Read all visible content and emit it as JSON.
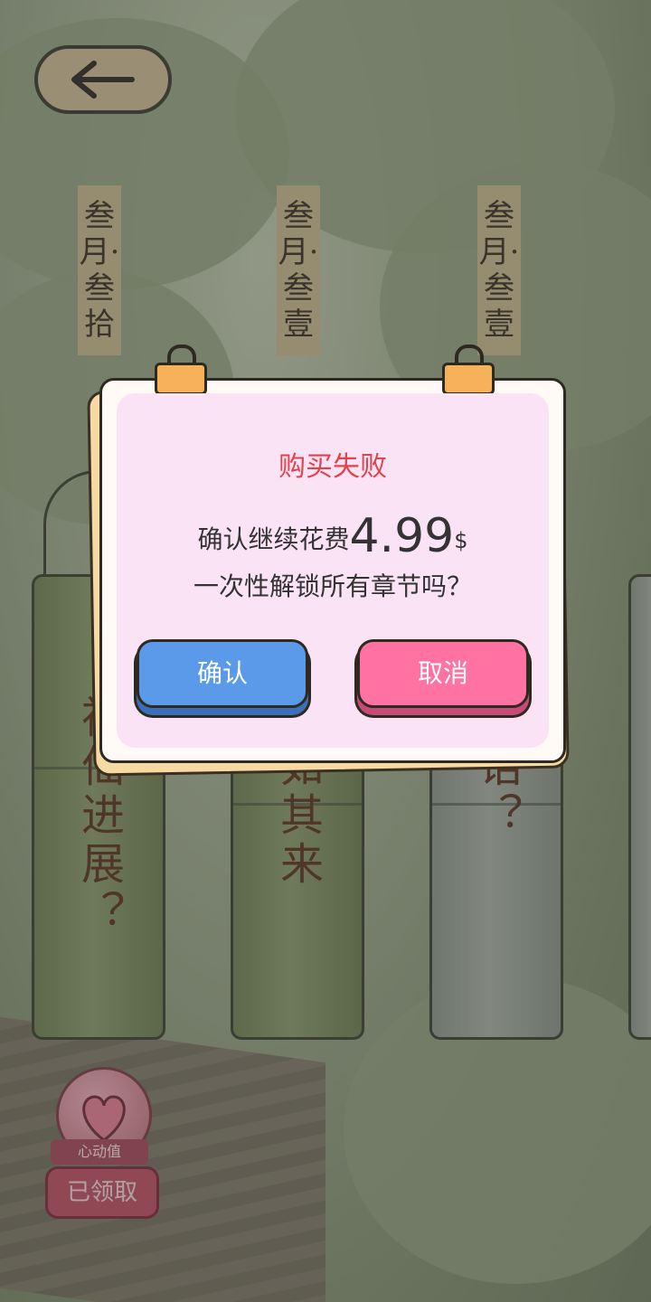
{
  "nav": {
    "back_icon": "arrow-left-icon"
  },
  "date_tags": [
    "叁月·叁拾",
    "叁月·叁壹",
    "叁月·叁壹"
  ],
  "chapter_tubes": [
    {
      "text": "神仙进展？"
    },
    {
      "text": "突如其来"
    },
    {
      "text": "心话？"
    }
  ],
  "heart_widget": {
    "icon": "heart-icon",
    "label": "心动值",
    "button": "已领取"
  },
  "dialog": {
    "title": "购买失败",
    "line1_prefix": "确认继续花费",
    "price": "4.99",
    "currency": "$",
    "line2": "一次性解锁所有章节吗？",
    "confirm_label": "确认",
    "cancel_label": "取消"
  },
  "colors": {
    "title_red": "#e2424a",
    "confirm_blue": "#5a9ae8",
    "cancel_pink": "#ff72a2",
    "dialog_pink": "#fbe3f6"
  }
}
